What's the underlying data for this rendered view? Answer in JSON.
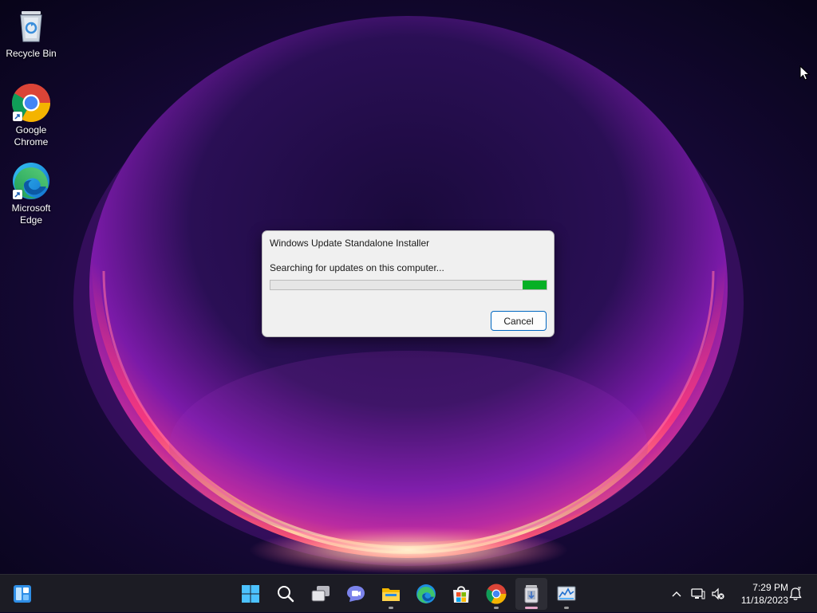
{
  "desktop": {
    "icons": [
      {
        "label": "Recycle Bin"
      },
      {
        "label": "Google Chrome"
      },
      {
        "label": "Microsoft Edge"
      }
    ]
  },
  "dialog": {
    "title": "Windows Update Standalone Installer",
    "message": "Searching for updates on this computer...",
    "progress": {
      "mode": "indeterminate",
      "segment_color": "#06b025"
    },
    "cancel_label": "Cancel"
  },
  "taskbar": {
    "widgets_icon": "widgets-icon",
    "pinned": [
      {
        "name": "start-icon"
      },
      {
        "name": "search-icon"
      },
      {
        "name": "task-view-icon"
      },
      {
        "name": "chat-icon"
      },
      {
        "name": "file-explorer-icon"
      },
      {
        "name": "edge-icon"
      },
      {
        "name": "microsoft-store-icon"
      },
      {
        "name": "chrome-icon"
      },
      {
        "name": "windows-update-installer-icon"
      },
      {
        "name": "resource-monitor-icon"
      }
    ],
    "tray": {
      "clock_time": "7:29 PM",
      "clock_date": "11/18/2023"
    }
  },
  "colors": {
    "accent": "#0067c0",
    "taskbar": "#1c1c24",
    "progress_green": "#06b025"
  }
}
